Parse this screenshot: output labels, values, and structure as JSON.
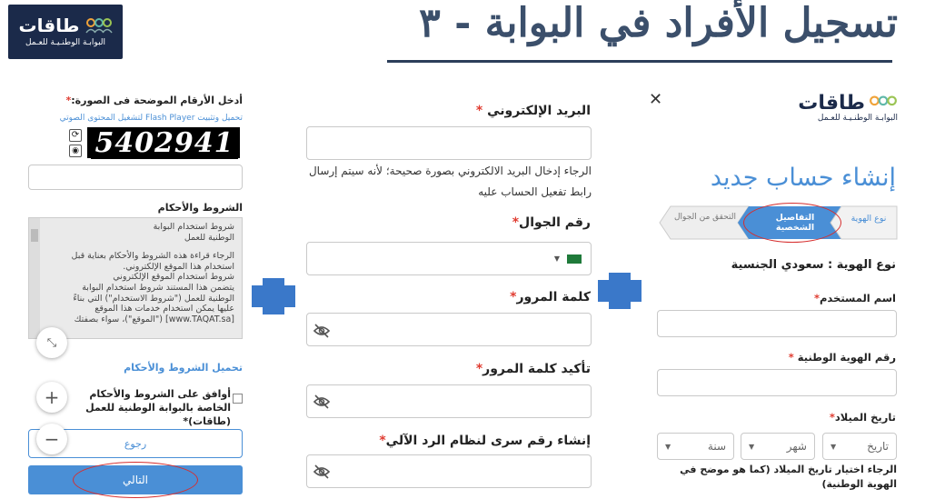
{
  "header": {
    "logo_brand": "طاقات",
    "logo_sub": "البوابـة الوطنـيـة للعـمل",
    "title": "تسجيل الأفراد في البوابة - ٣"
  },
  "left": {
    "captcha_label": "أدخل الأرقام الموضحة فى الصورة:",
    "captcha_hint": "تحميل وتثبيت Flash Player لتشغيل المحتوى الصوتي",
    "captcha_text": "5402941",
    "terms_label": "الشروط والأحكام",
    "terms_lines": [
      "شروط استخدام البوابة",
      "الوطنية للعمل",
      "",
      "الرجاء قراءة هذه الشروط والأحكام بعناية قبل",
      "استخدام هذا الموقع الإلكتروني.",
      "شروط استخدام الموقع الإلكتروني",
      "يتضمن هذا المستند شروط استخدام البوابة",
      "الوطنية للعمل (\"شروط الاستخدام\") التي بناءً",
      "عليها يمكن استخدام خدمات هذا الموقع",
      "[www.TAQAT.sa] (\"الموقع\")، سواء بصفتك"
    ],
    "download_terms": "تحميل الشروط والأحكام",
    "agree_text": "أوافق على الشروط والأحكام الخاصة بالبوابة الوطنية للعمل (طاقات)*",
    "back_button": "رجوع",
    "next_button": "التالي"
  },
  "middle": {
    "email_label": "البريد الإلكتروني",
    "email_hint": "الرجاء إدخال البريد الالكتروني بصورة صحيحة؛ لأنه سيتم إرسال رابط تفعيل الحساب عليه",
    "mobile_label": "رقم الجوال",
    "password_label": "كلمة المرور",
    "confirm_label": "تأكيد كلمة المرور",
    "ivr_label": "إنشاء رقم سرى لنظام الرد الآلي"
  },
  "right": {
    "logo_brand": "طاقات",
    "logo_sub": "البوابـة الوطنـيـة للعـمل",
    "create_title": "إنشاء حساب جديد",
    "steps": [
      "نوع الهوية",
      "التفاصيل الشخصية",
      "التحقق من الجوال"
    ],
    "id_type": "نوع الهوية : سعودي الجنسية",
    "username_label": "اسم المستخدم",
    "national_id_label": "رقم الهوية الوطنية",
    "dob_label": "تاريخ الميلاد",
    "dob_day": "تاريخ",
    "dob_month": "شهر",
    "dob_year": "سنة",
    "dob_hint": "الرجاء اختيار تاريخ الميلاد (كما هو موضح في الهوية الوطنية)"
  },
  "colors": {
    "accent": "#4a8fd6",
    "brand_dark": "#1b2a4a",
    "required": "#e03c31",
    "annotation": "#d62e2e",
    "title": "#3b4f6b"
  }
}
